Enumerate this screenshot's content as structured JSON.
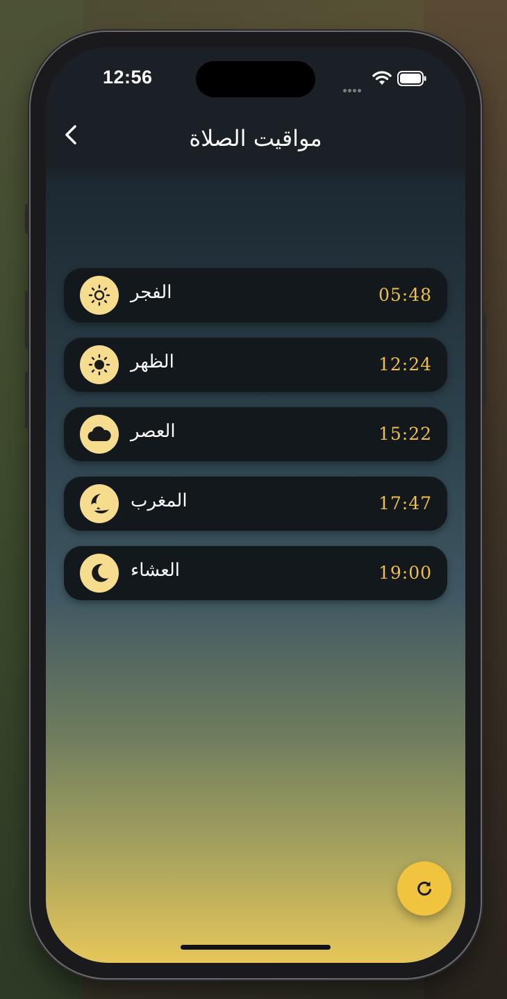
{
  "status_bar": {
    "time": "12:56"
  },
  "header": {
    "title": "مواقيت الصلاة"
  },
  "prayers": [
    {
      "name": "الفجر",
      "time": "05:48",
      "icon": "sun-outline-icon"
    },
    {
      "name": "الظهر",
      "time": "12:24",
      "icon": "sun-filled-icon"
    },
    {
      "name": "العصر",
      "time": "15:22",
      "icon": "cloud-icon"
    },
    {
      "name": "المغرب",
      "time": "17:47",
      "icon": "sunset-moon-icon"
    },
    {
      "name": "العشاء",
      "time": "19:00",
      "icon": "moon-icon"
    }
  ],
  "fab": {
    "icon": "refresh-icon"
  },
  "colors": {
    "accent": "#f0c43f",
    "time_text": "#f0c040",
    "card_bg": "#13181c",
    "icon_bg": "#f6dd8e"
  }
}
